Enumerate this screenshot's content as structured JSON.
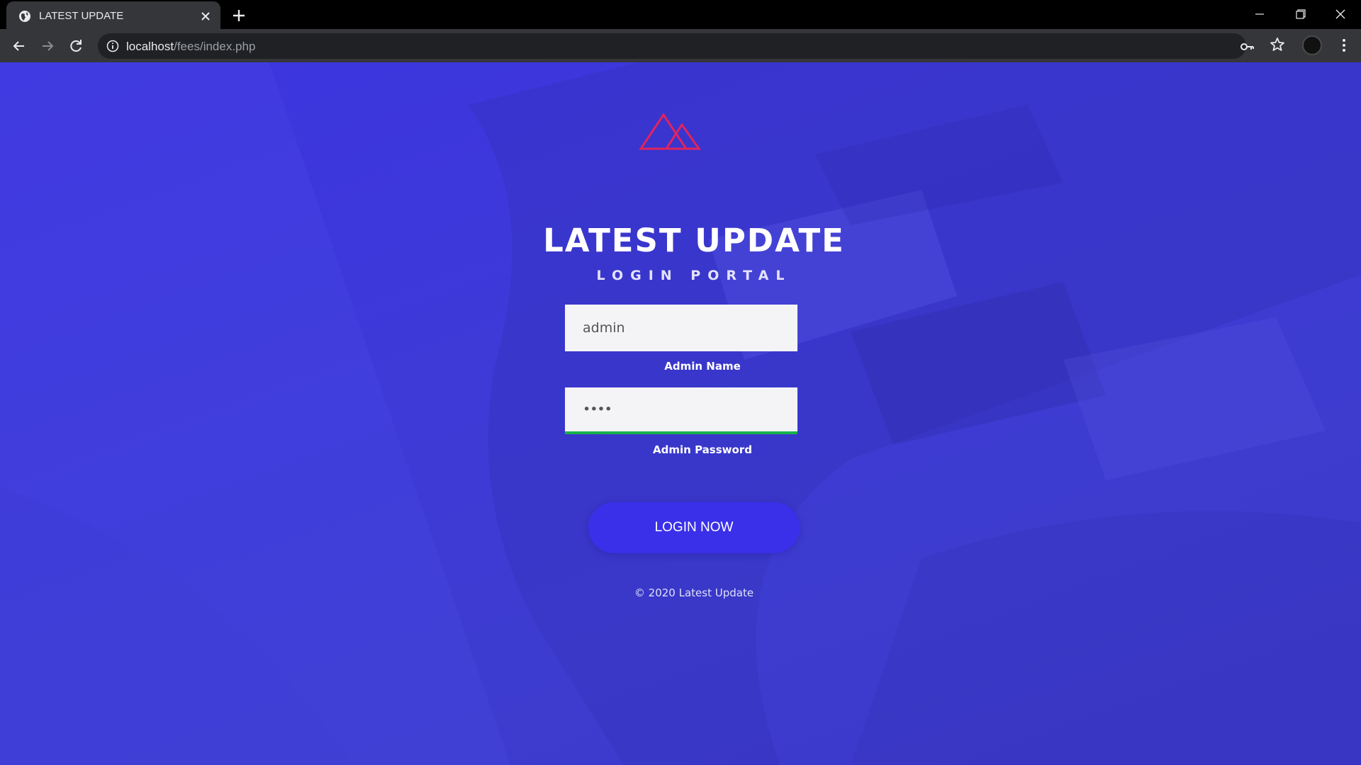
{
  "browser": {
    "tab_title": "LATEST UPDATE",
    "url_host": "localhost",
    "url_path": "/fees/index.php",
    "icons": [
      "globe-icon",
      "close-icon",
      "plus-icon",
      "minimize-icon",
      "restore-icon",
      "close-window-icon",
      "back-icon",
      "forward-icon",
      "reload-icon",
      "info-icon",
      "key-icon",
      "star-icon",
      "menu-icon"
    ]
  },
  "page": {
    "title": "LATEST UPDATE",
    "subtitle": "LOGIN PORTAL",
    "username": {
      "value": "admin",
      "label": "Admin Name"
    },
    "password": {
      "value": "••••",
      "label": "Admin Password"
    },
    "login_button": "LOGIN NOW",
    "footer": "© 2020 Latest Update"
  },
  "colors": {
    "background": "#3d3ad8",
    "logo": "#e0245e",
    "button": "#3a30ea",
    "focus_underline": "#19b24a"
  }
}
